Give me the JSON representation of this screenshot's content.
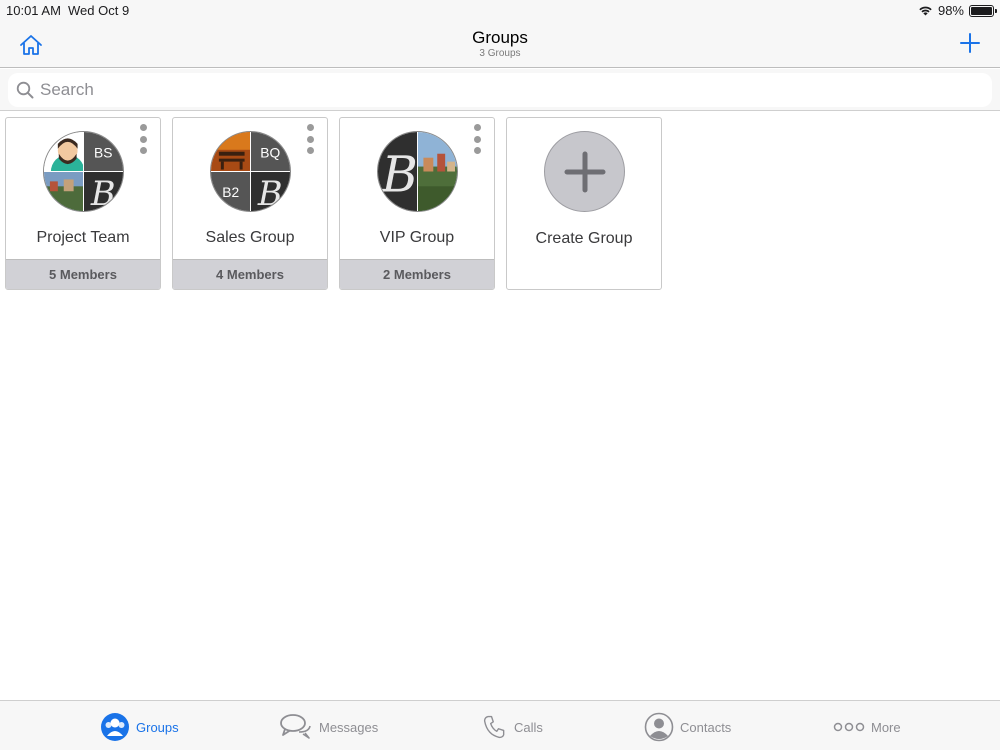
{
  "status_bar": {
    "time": "10:01 AM",
    "date": "Wed Oct 9",
    "battery": "98%",
    "battery_level": 0.98
  },
  "header": {
    "title": "Groups",
    "subtitle": "3 Groups"
  },
  "search": {
    "placeholder": "Search",
    "value": ""
  },
  "groups": [
    {
      "name": "Project Team",
      "members": "5 Members",
      "initials": [
        "BS"
      ]
    },
    {
      "name": "Sales Group",
      "members": "4 Members",
      "initials": [
        "BQ",
        "B2"
      ]
    },
    {
      "name": "VIP Group",
      "members": "2 Members",
      "initials": []
    }
  ],
  "create_group": {
    "label": "Create Group"
  },
  "tabs": [
    {
      "label": "Groups",
      "icon": "groups-icon",
      "active": true
    },
    {
      "label": "Messages",
      "icon": "messages-icon",
      "active": false
    },
    {
      "label": "Calls",
      "icon": "phone-icon",
      "active": false
    },
    {
      "label": "Contacts",
      "icon": "contact-icon",
      "active": false
    },
    {
      "label": "More",
      "icon": "more-icon",
      "active": false
    }
  ],
  "colors": {
    "accent": "#1a73e8",
    "inactive": "#8e8e93",
    "footer_bg": "#d1d1d6"
  }
}
